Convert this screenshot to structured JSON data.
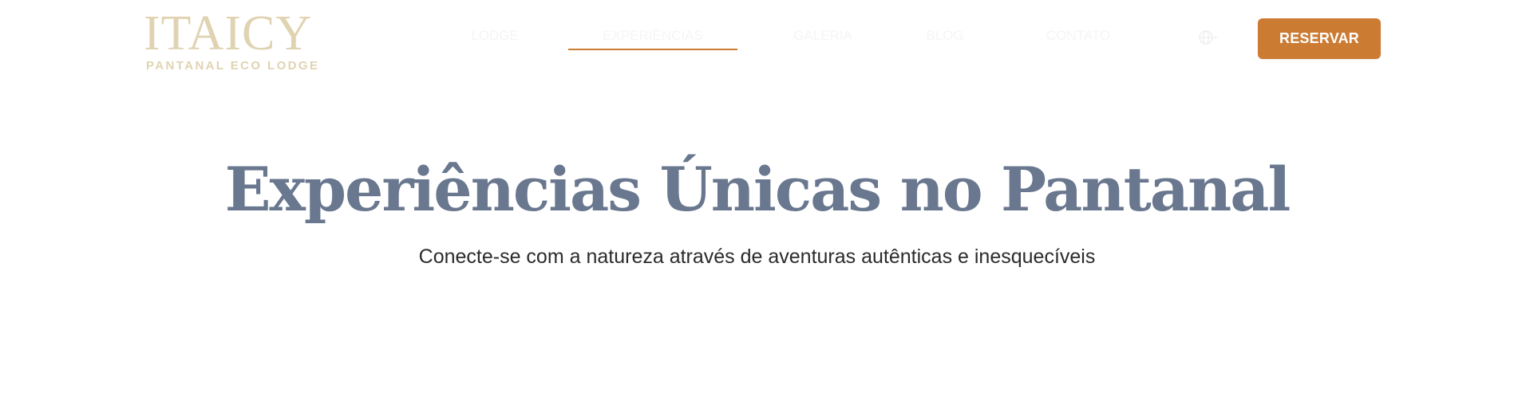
{
  "brand": {
    "name": "ITAICY",
    "tagline": "PANTANAL ECO LODGE",
    "logo_color": "#e0d3b2"
  },
  "nav": {
    "items": [
      {
        "label": "LODGE",
        "active": false
      },
      {
        "label": "EXPERIÊNCIAS",
        "active": true
      },
      {
        "label": "GALERIA",
        "active": false
      },
      {
        "label": "BLOG",
        "active": false
      },
      {
        "label": "CONTATO",
        "active": false
      }
    ],
    "language_icon": "globe-icon",
    "active_color": "#cc7b32"
  },
  "header": {
    "reserve_label": "RESERVAR",
    "reserve_color": "#cc7b32"
  },
  "hero": {
    "title": "Experiências Únicas no Pantanal",
    "subtitle": "Conecte-se com a natureza através de aventuras autênticas e inesquecíveis",
    "title_color": "#69778f"
  }
}
